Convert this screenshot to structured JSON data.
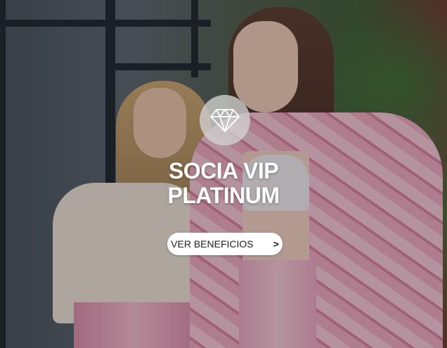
{
  "banner": {
    "title_line1": "SOCIA VIP",
    "title_line2": "PLATINUM",
    "badge_icon": "diamond-icon",
    "cta_label": "VER BENEFICIOS",
    "cta_chevron": ">",
    "colors": {
      "title": "#ffffff",
      "badge_bg": "#d2d2d2",
      "cta_bg": "#ffffff",
      "cta_text": "#222222"
    }
  }
}
